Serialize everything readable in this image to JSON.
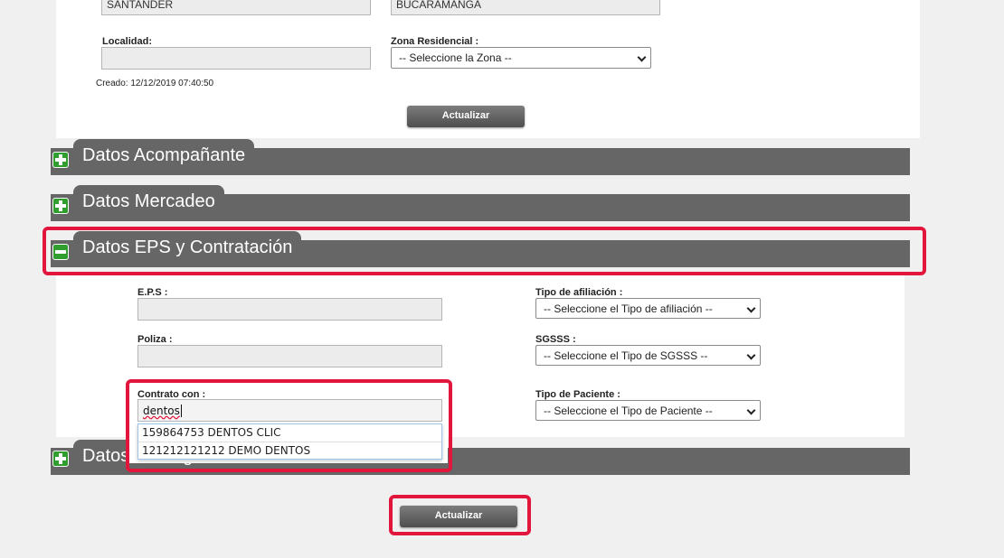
{
  "location": {
    "departamento_value": "SANTANDER",
    "municipio_value": "BUCARAMANGA",
    "localidad_label": "Localidad:",
    "localidad_value": "",
    "zona_label": "Zona Residencial :",
    "zona_selected": "-- Seleccione la Zona --",
    "created_text": "Creado: 12/12/2019 07:40:50",
    "update_button": "Actualizar"
  },
  "sections": {
    "acompanante": "Datos Acompañante",
    "mercadeo": "Datos Mercadeo",
    "eps": "Datos EPS y Contratación",
    "demograficos": "Datos Demográficos"
  },
  "eps_form": {
    "eps_label": "E.P.S :",
    "eps_value": "",
    "tipo_afiliacion_label": "Tipo de afiliación :",
    "tipo_afiliacion_selected": "-- Seleccione el Tipo de afiliación --",
    "poliza_label": "Poliza :",
    "poliza_value": "",
    "sgsss_label": "SGSSS :",
    "sgsss_selected": "-- Seleccione el Tipo de SGSSS --",
    "contrato_label": "Contrato con :",
    "contrato_value": "dentos",
    "tipo_paciente_label": "Tipo de Paciente :",
    "tipo_paciente_selected": "-- Seleccione el Tipo de Paciente --",
    "suggestions": [
      "159864753 DENTOS CLIC",
      "121212121212 DEMO DENTOS"
    ]
  },
  "footer": {
    "update_button": "Actualizar"
  },
  "colors": {
    "section_bar": "#666666",
    "highlight": "#e2153c",
    "icon_green": "#2f9e2f"
  }
}
